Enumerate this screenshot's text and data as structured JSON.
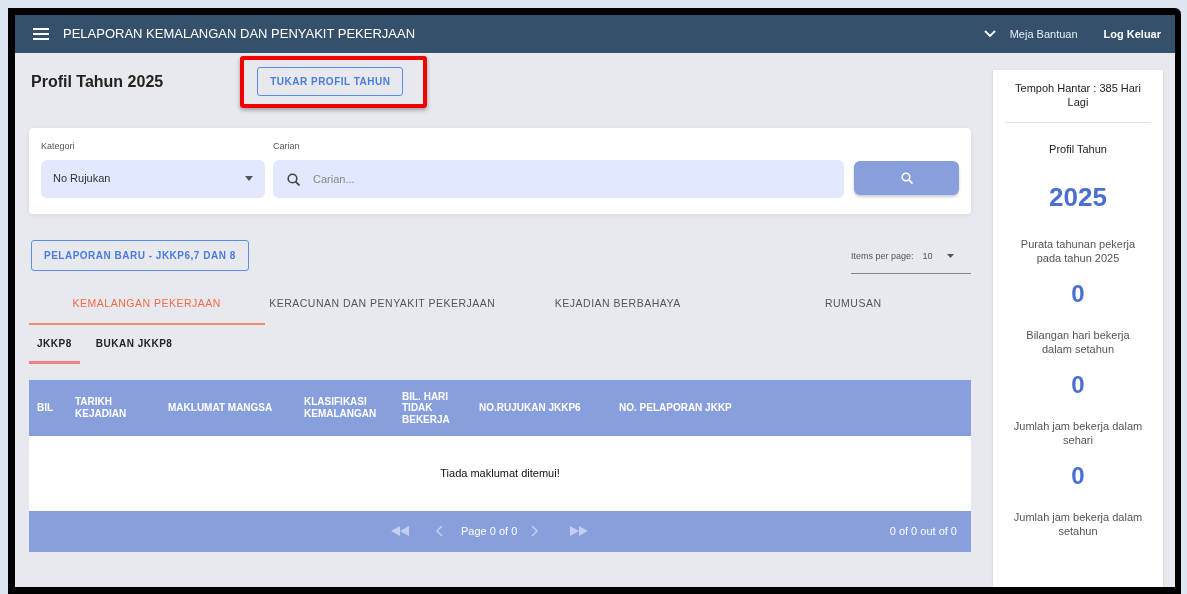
{
  "nav": {
    "title": "PELAPORAN KEMALANGAN DAN PENYAKIT PEKERJAAN",
    "links": [
      {
        "label": "Meja Bantuan"
      },
      {
        "label": "Log Keluar"
      }
    ]
  },
  "page": {
    "heading": "Profil Tahun 2025",
    "change_button": {
      "label": "TUKAR PROFIL TAHUN",
      "highlighted": true
    }
  },
  "filters": {
    "category_label": "Kategori",
    "category_value": "No Rujukan",
    "search_label": "Carian",
    "search_placeholder": "Carian..."
  },
  "new_report_button": "PELAPORAN BARU - JKKP6,7 DAN 8",
  "items_per_page": {
    "label": "Items per page:",
    "value": "10"
  },
  "tabs": [
    {
      "label": "KEMALANGAN PEKERJAAN",
      "selected": true
    },
    {
      "label": "KERACUNAN DAN PENYAKIT PEKERJAAN",
      "selected": false
    },
    {
      "label": "KEJADIAN BERBAHAYA",
      "selected": false
    },
    {
      "label": "RUMUSAN",
      "selected": false
    }
  ],
  "subtabs": [
    {
      "label": "JKKP8",
      "selected": true
    },
    {
      "label": "BUKAN JKKP8",
      "selected": false
    }
  ],
  "table": {
    "columns": [
      "BIL",
      "TARIKH KEJADIAN",
      "MAKLUMAT MANGSA",
      "KLASIFIKASI KEMALANGAN",
      "BIL. HARI TIDAK BEKERJA",
      "NO.RUJUKAN JKKP6",
      "NO. PELAPORAN JKKP"
    ],
    "empty_message": "Tiada maklumat ditemui!",
    "pager": {
      "page": "Page 0 of 0",
      "range": "0 of 0 out of 0"
    }
  },
  "sidebar": {
    "deadline": "Tempoh Hantar : 385 Hari Lagi",
    "profile_label": "Profil Tahun",
    "profile_year": "2025",
    "stats": [
      {
        "caption": "Purata tahunan pekerja pada tahun 2025",
        "value": "0"
      },
      {
        "caption": "Bilangan hari bekerja dalam setahun",
        "value": "0"
      },
      {
        "caption": "Jumlah jam bekerja dalam sehari",
        "value": "0"
      },
      {
        "caption": "Jumlah jam bekerja dalam setahun"
      }
    ]
  }
}
